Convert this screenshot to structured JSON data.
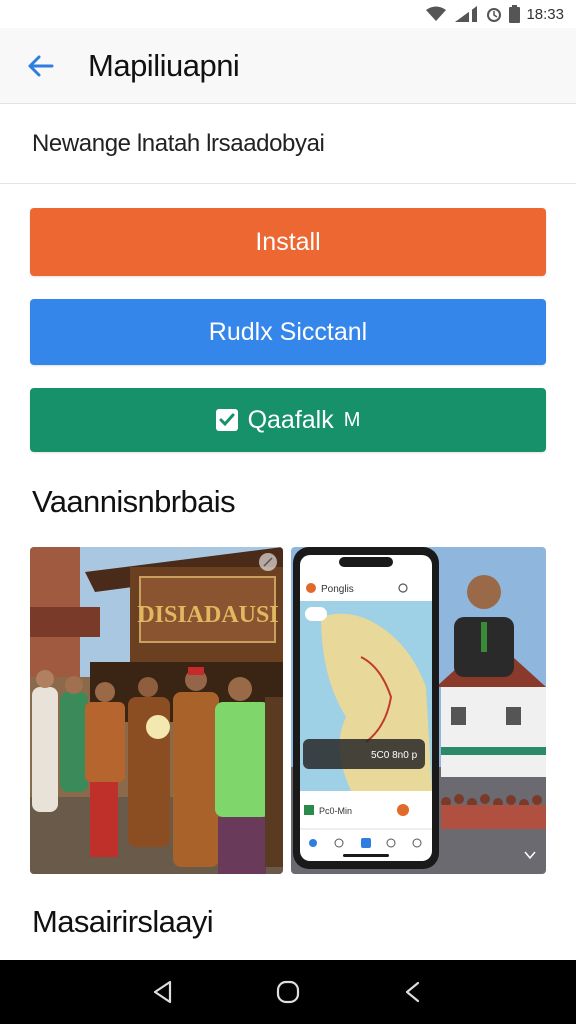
{
  "status_bar": {
    "time": "18:33",
    "icons": [
      "wifi-icon",
      "signal-icon",
      "alarm-icon",
      "battery-icon"
    ]
  },
  "app_bar": {
    "title": "Mapiliuapni",
    "back_icon": "arrow-left-icon",
    "accent_color": "#2f7de0"
  },
  "subtitle": "Newange lnatah lrsaadobyai",
  "buttons": {
    "install": {
      "label": "Install",
      "color": "#ec6731"
    },
    "primary": {
      "label": "Rudlx Sicctanl",
      "color": "#3486ea"
    },
    "secondary": {
      "label": "Qaafalk",
      "suffix": "M",
      "icon": "check-square-icon",
      "color": "#16916a"
    }
  },
  "gallery": {
    "heading": "Vaannisnbrbais",
    "items": [
      {
        "sign_text": "DISIADAUSI",
        "icon": "expand-icon"
      },
      {
        "app_header": "Ponglis",
        "panel_text": "5C0 8n0 p",
        "list_text": "Pc0-Min",
        "icon": "chevron-down-icon"
      }
    ]
  },
  "second_section": {
    "heading": "Masairirslaayi"
  },
  "nav_bar": {
    "items": [
      "back-triangle-icon",
      "home-circle-icon",
      "recents-icon"
    ]
  }
}
